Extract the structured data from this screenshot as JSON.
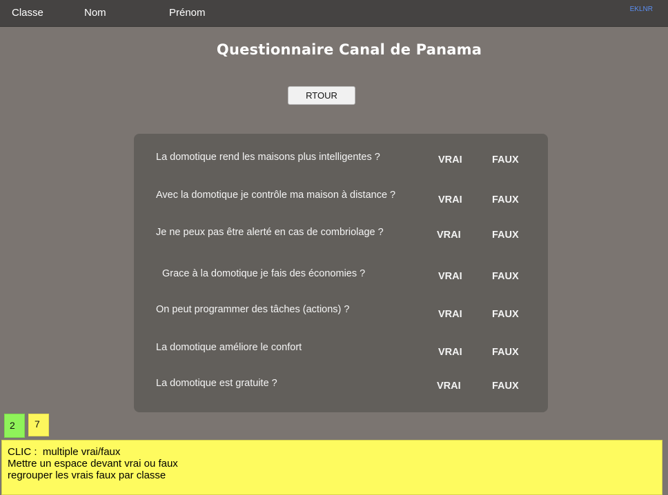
{
  "header": {
    "classe": "Classe",
    "nom": "Nom",
    "prenom": "Prénom",
    "code": "EKLNR"
  },
  "title": "Questionnaire Canal de Panama",
  "rtour_label": "RTOUR",
  "questions": [
    {
      "text": "La domotique rend les maisons plus intelligentes ?",
      "vrai": "VRAI",
      "faux": "FAUX"
    },
    {
      "text": "Avec la domotique je contrôle ma maison à distance ?",
      "vrai": "VRAI",
      "faux": "FAUX"
    },
    {
      "text": "Je ne peux pas être alerté en cas de combriolage ?",
      "vrai": "VRAI",
      "faux": "FAUX"
    },
    {
      "text": "Grace à la domotique je fais des économies  ?",
      "vrai": "VRAI",
      "faux": "FAUX"
    },
    {
      "text": "On peut programmer des tâches (actions) ?",
      "vrai": "VRAI",
      "faux": "FAUX"
    },
    {
      "text": "La domotique améliore le confort",
      "vrai": "VRAI",
      "faux": "FAUX"
    },
    {
      "text": "La domotique est gratuite ?",
      "vrai": "VRAI",
      "faux": "FAUX"
    }
  ],
  "badges": {
    "green": "2",
    "yellow": "7"
  },
  "note": {
    "line1": "CLIC :  multiple vrai/faux",
    "line2": "Mettre un espace devant vrai ou faux",
    "line3": "regrouper les vrais faux par classe"
  }
}
